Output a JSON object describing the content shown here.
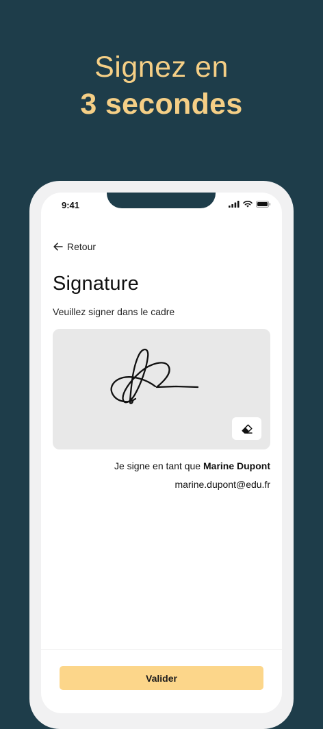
{
  "headline": {
    "line1": "Signez en",
    "line2": "3 secondes"
  },
  "status_bar": {
    "time": "9:41",
    "icons": [
      "cellular-signal-icon",
      "wifi-icon",
      "battery-icon"
    ]
  },
  "nav": {
    "back_label": "Retour",
    "back_icon": "arrow-left-icon"
  },
  "screen": {
    "title": "Signature",
    "instruction": "Veuillez signer dans le cadre"
  },
  "signature_pad": {
    "erase_icon": "eraser-icon"
  },
  "signer": {
    "prefix": "Je signe en tant que",
    "name": "Marine Dupont",
    "email": "marine.dupont@edu.fr"
  },
  "footer": {
    "validate_label": "Valider"
  },
  "colors": {
    "background": "#1e3d4a",
    "headline": "#f5cf86",
    "button": "#fcd68a",
    "pad": "#e8e8e8"
  }
}
